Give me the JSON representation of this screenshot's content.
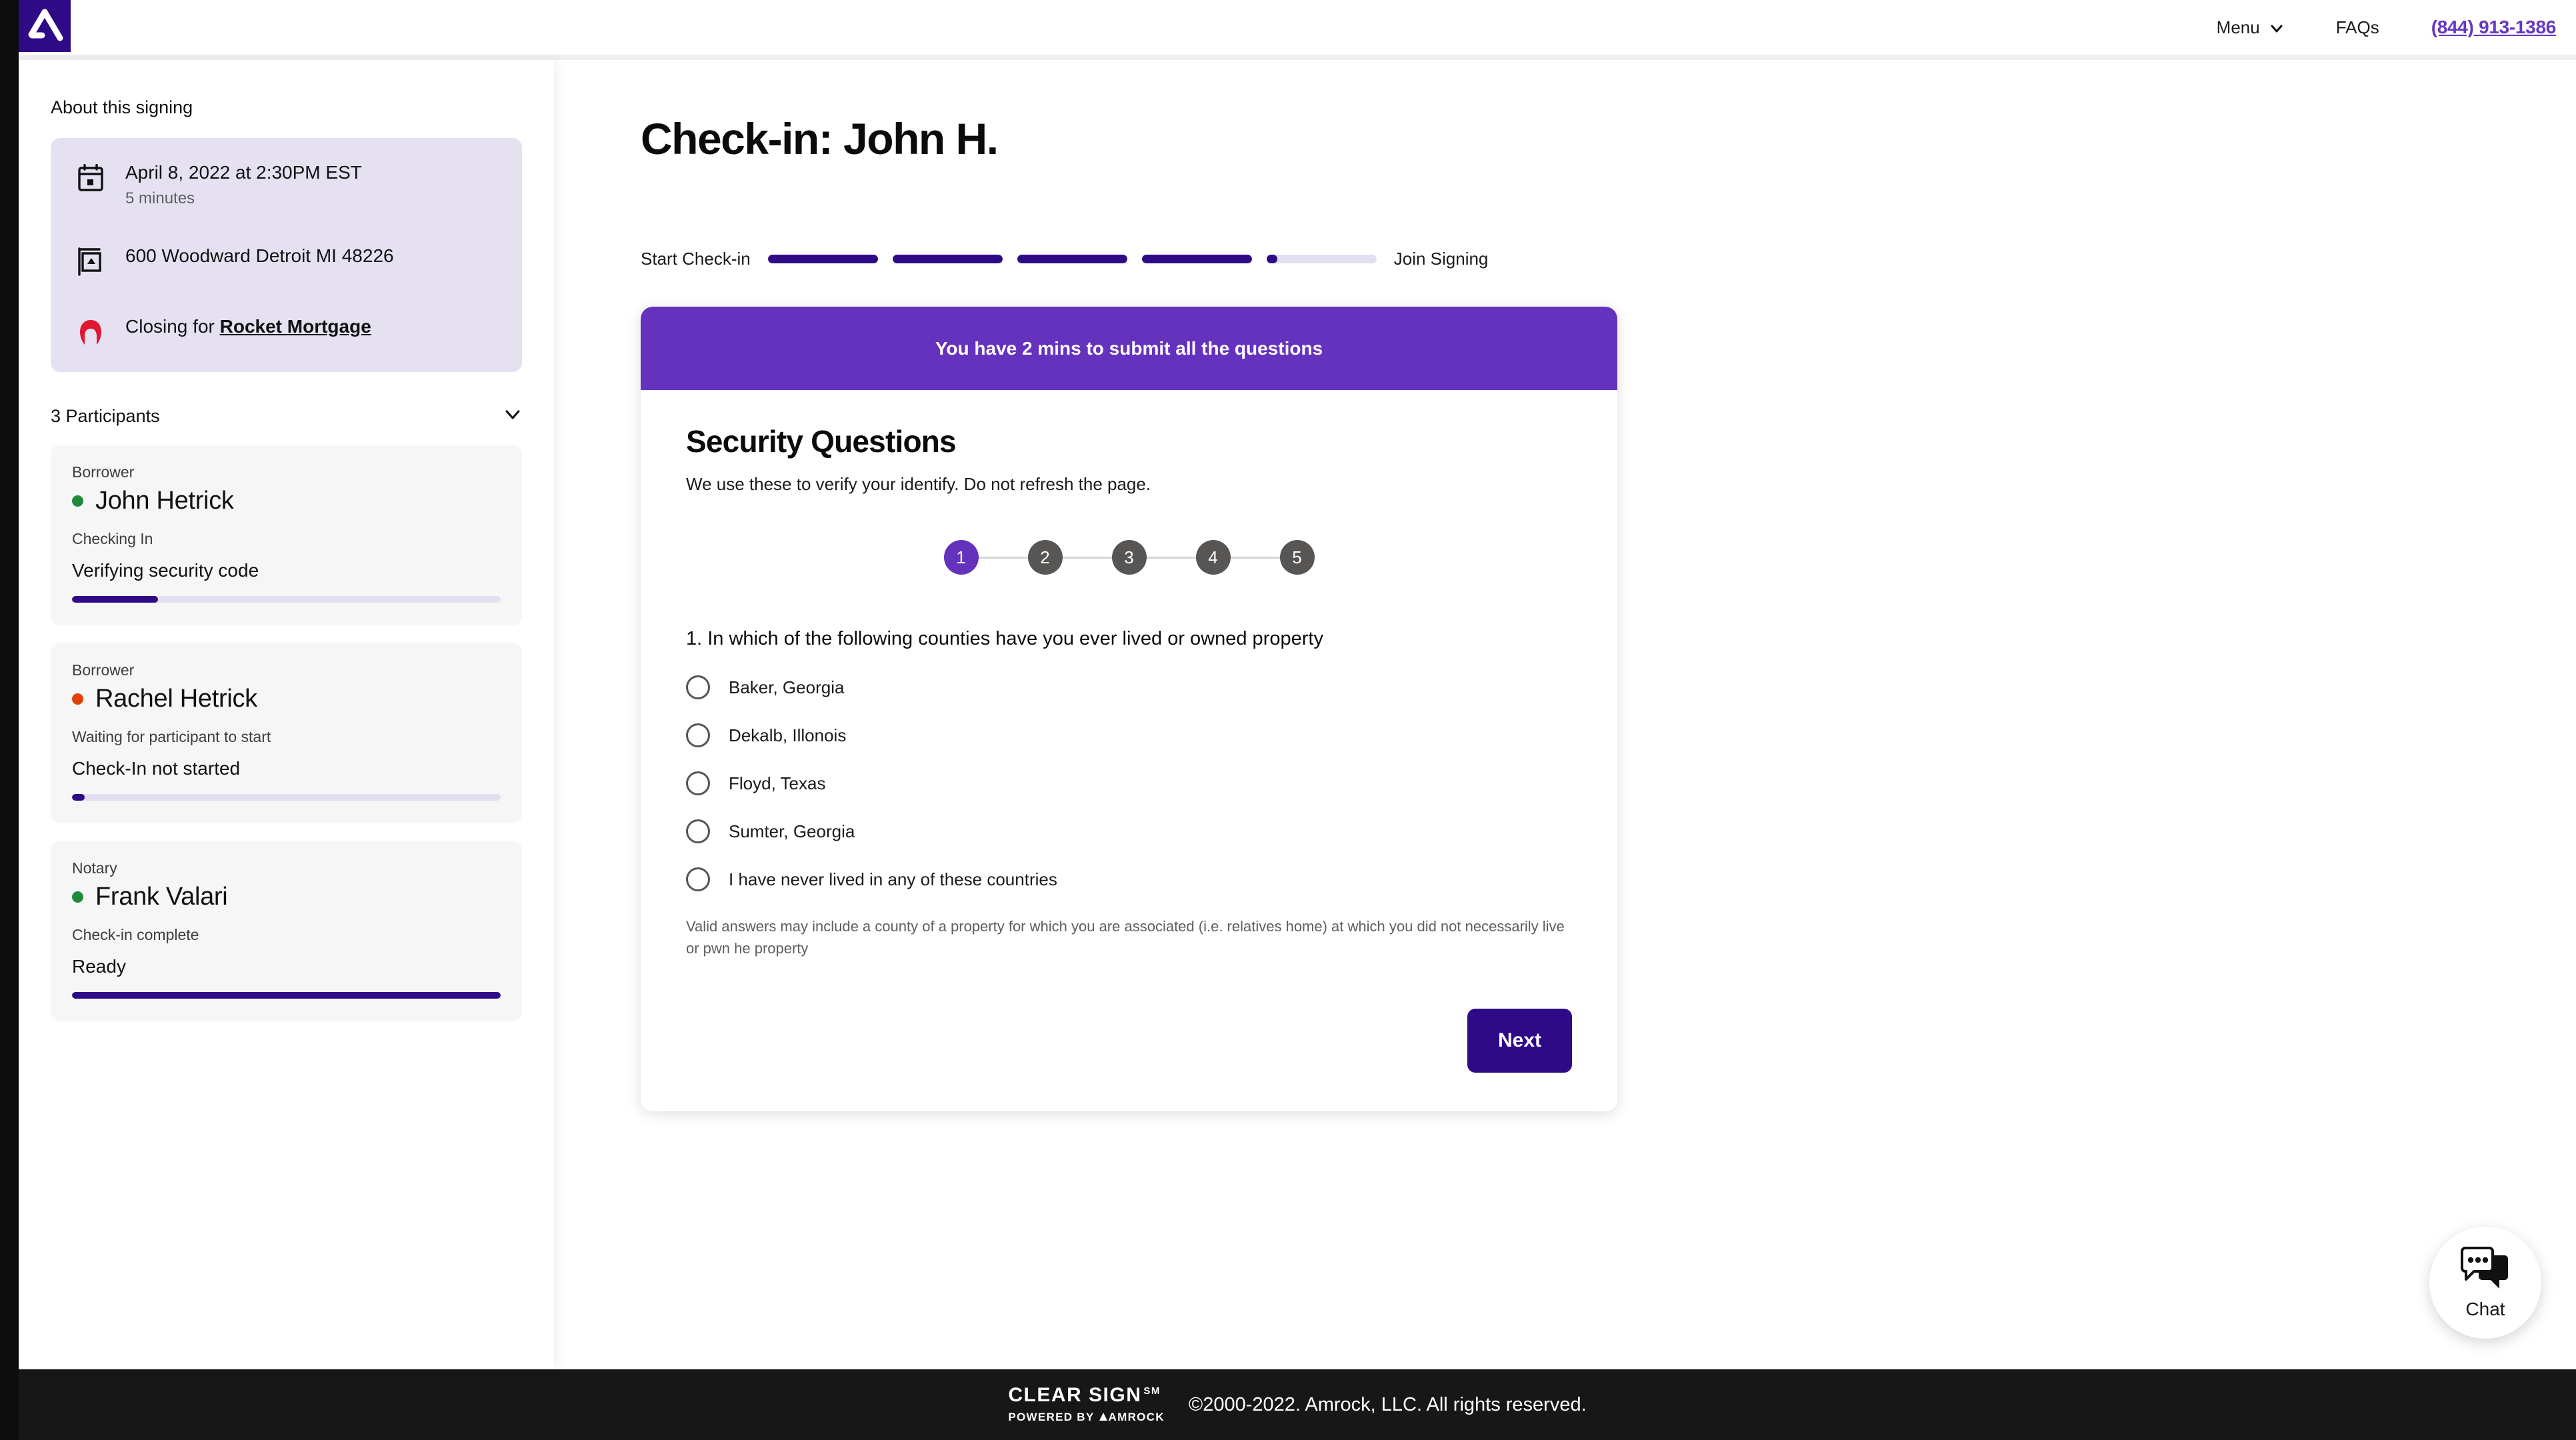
{
  "header": {
    "logo_icon": "amrock-logo-icon",
    "logo_bg": "#2e0a87",
    "menu_label": "Menu",
    "menu_chevron_icon": "chevron-down-icon",
    "faqs_label": "FAQs",
    "phone_label": "(844) 913-1386",
    "phone_color": "#6638c0"
  },
  "sidebar": {
    "about_title": "About this signing",
    "about": {
      "date_icon": "calendar-icon",
      "date": "April 8, 2022 at 2:30PM EST",
      "duration": "5 minutes",
      "address_icon": "property-sign-icon",
      "address": "600 Woodward Detroit MI 48226",
      "lender_icon": "rocket-mortgage-icon",
      "closing_prefix": "Closing for ",
      "closing_lender": "Rocket Mortgage"
    },
    "participants_title": "3 Participants",
    "participants_chevron_icon": "chevron-down-icon",
    "participants": [
      {
        "role": "Borrower",
        "name": "John Hetrick",
        "dot_color": "#1f8a3b",
        "status": "Checking In",
        "state": "Verifying security code",
        "progress": 20
      },
      {
        "role": "Borrower",
        "name": "Rachel Hetrick",
        "dot_color": "#e24109",
        "status": "Waiting for participant to start",
        "state": "Check-In not started",
        "progress": 3
      },
      {
        "role": "Notary",
        "name": "Frank Valari",
        "dot_color": "#1f8a3b",
        "status": "Check-in complete",
        "state": "Ready",
        "progress": 100
      }
    ]
  },
  "main": {
    "page_title": "Check-in: John H.",
    "stepper": {
      "start_label": "Start Check-in",
      "end_label": "Join Signing",
      "segments": [
        100,
        100,
        100,
        100,
        10
      ]
    },
    "card": {
      "banner_text": "You have 2 mins to submit all the questions",
      "banner_color": "#6532bd",
      "heading": "Security Questions",
      "subheading": "We use these to verify your identify. Do not refresh the page.",
      "steps": [
        "1",
        "2",
        "3",
        "4",
        "5"
      ],
      "active_step": 1,
      "question_number": "1.",
      "question_text": "In which of the following counties have you ever lived or owned property",
      "options": [
        "Baker, Georgia",
        "Dekalb, Illonois",
        "Floyd, Texas",
        "Sumter, Georgia",
        "I have never lived in any of these countries"
      ],
      "fineprint": "Valid answers may include a county of a property for which you are associated (i.e. relatives home) at which you did not necessarily live or pwn he property",
      "next_label": "Next"
    }
  },
  "chat": {
    "icon": "chat-bubbles-icon",
    "label": "Chat"
  },
  "footer": {
    "brand_top": "CLEAR SIGN",
    "brand_sm": "SM",
    "brand_bottom_prefix": "POWERED BY",
    "brand_bottom_name": "AMROCK",
    "copyright": "©2000-2022. Amrock, LLC. All rights reserved."
  }
}
